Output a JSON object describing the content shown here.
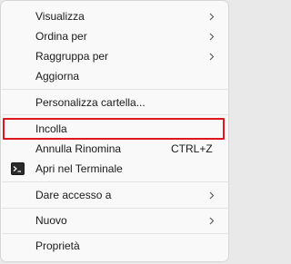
{
  "menu": {
    "items": [
      {
        "label": "Visualizza",
        "has_submenu": true
      },
      {
        "label": "Ordina per",
        "has_submenu": true
      },
      {
        "label": "Raggruppa per",
        "has_submenu": true
      },
      {
        "label": "Aggiorna"
      },
      {
        "label": "Personalizza cartella..."
      },
      {
        "label": "Incolla",
        "highlighted": true,
        "highlight_color": "#e0161d"
      },
      {
        "label": "Annulla Rinomina",
        "shortcut": "CTRL+Z"
      },
      {
        "label": "Apri nel Terminale",
        "icon": "terminal-icon"
      },
      {
        "label": "Dare accesso a",
        "has_submenu": true
      },
      {
        "label": "Nuovo",
        "has_submenu": true
      },
      {
        "label": "Proprietà"
      }
    ]
  }
}
